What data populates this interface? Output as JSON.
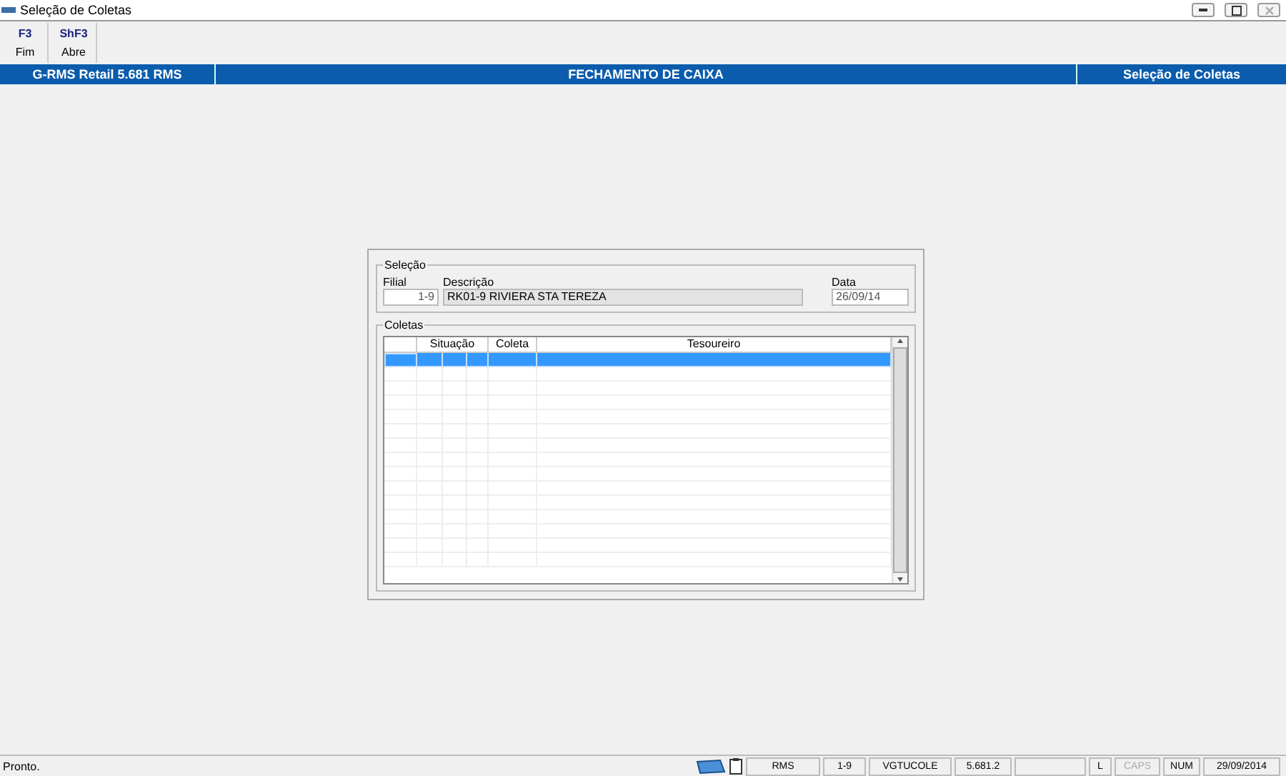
{
  "window": {
    "title": "Seleção de Coletas"
  },
  "toolbar": [
    {
      "key": "F3",
      "label": "Fim"
    },
    {
      "key": "ShF3",
      "label": "Abre"
    }
  ],
  "header": {
    "system": "G-RMS Retail 5.681 RMS",
    "module": "FECHAMENTO DE CAIXA",
    "screen": "Seleção de Coletas"
  },
  "selecao": {
    "title": "Seleção",
    "filial": {
      "label": "Filial",
      "value": "1-9"
    },
    "descricao": {
      "label": "Descrição",
      "value": "RK01-9 RIVIERA STA TEREZA"
    },
    "data": {
      "label": "Data",
      "value": "26/09/14"
    }
  },
  "coletas": {
    "title": "Coletas",
    "columns": [
      "Situação",
      "Coleta",
      "Tesoureiro"
    ],
    "rows": [
      {
        "selected": true
      },
      {
        "selected": false
      },
      {
        "selected": false
      },
      {
        "selected": false
      },
      {
        "selected": false
      },
      {
        "selected": false
      },
      {
        "selected": false
      },
      {
        "selected": false
      },
      {
        "selected": false
      },
      {
        "selected": false
      },
      {
        "selected": false
      },
      {
        "selected": false
      },
      {
        "selected": false
      },
      {
        "selected": false
      },
      {
        "selected": false
      }
    ]
  },
  "status_bar": {
    "message": "Pronto.",
    "panels": [
      {
        "text": "RMS",
        "disabled": false
      },
      {
        "text": "1-9",
        "disabled": false
      },
      {
        "text": "VGTUCOLE",
        "disabled": false
      },
      {
        "text": "5.681.2",
        "disabled": false
      },
      {
        "text": "L",
        "disabled": false
      },
      {
        "text": "CAPS",
        "disabled": true
      },
      {
        "text": "NUM",
        "disabled": false
      },
      {
        "text": "29/09/2014",
        "disabled": false
      }
    ]
  }
}
